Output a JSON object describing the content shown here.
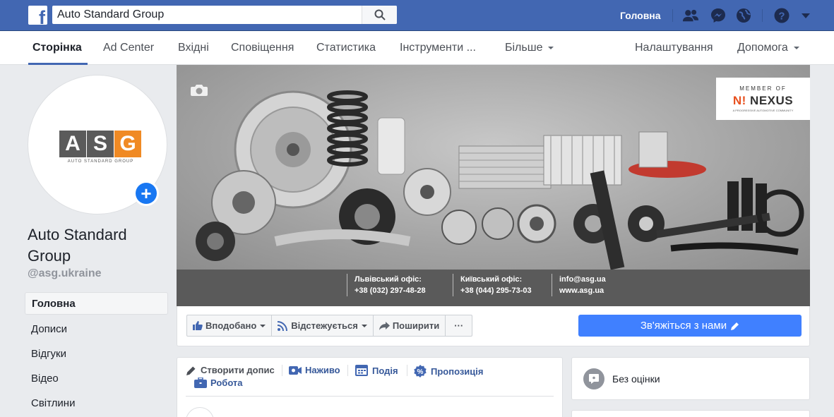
{
  "topbar": {
    "logo_letter": "f",
    "search_value": "Auto Standard Group",
    "home_label": "Головна"
  },
  "nav": {
    "tabs": [
      {
        "label": "Сторінка",
        "active": true
      },
      {
        "label": "Ad Center"
      },
      {
        "label": "Вхідні"
      },
      {
        "label": "Сповіщення"
      },
      {
        "label": "Статистика"
      },
      {
        "label": "Інструменти ..."
      },
      {
        "label": "Більше"
      }
    ],
    "settings_label": "Налаштування",
    "help_label": "Допомога"
  },
  "profile": {
    "logo_letters": [
      "A",
      "S",
      "G"
    ],
    "logo_colors": [
      "#5b5b5b",
      "#5b5b5b",
      "#f08a24"
    ],
    "logo_subtitle": "AUTO STANDARD GROUP",
    "name": "Auto Standard Group",
    "handle": "@asg.ukraine"
  },
  "sidebar": {
    "items": [
      {
        "label": "Головна",
        "active": true
      },
      {
        "label": "Дописи"
      },
      {
        "label": "Відгуки"
      },
      {
        "label": "Відео"
      },
      {
        "label": "Світлини"
      }
    ]
  },
  "cover": {
    "nexus": {
      "top": "MEMBER OF",
      "n_mark": "N!",
      "word": "NEXUS",
      "sub": "A PROGRESSIVE AUTOMOTIVE COMMUNITY"
    },
    "contacts": [
      {
        "title": "Львівський офіс:",
        "value": "+38 (032) 297-48-28"
      },
      {
        "title": "Київський офіс:",
        "value": "+38 (044) 295-73-03"
      },
      {
        "title": "info@asg.ua",
        "value": "www.asg.ua"
      }
    ]
  },
  "actions": {
    "liked_label": "Вподобано",
    "following_label": "Відстежується",
    "share_label": "Поширити",
    "more_label": "···",
    "contact_label": "Зв'яжіться з нами"
  },
  "create_post": {
    "create_label": "Створити допис",
    "live_label": "Наживо",
    "event_label": "Подія",
    "offer_label": "Пропозиція",
    "job_label": "Робота"
  },
  "rating": {
    "label": "Без оцінки"
  }
}
